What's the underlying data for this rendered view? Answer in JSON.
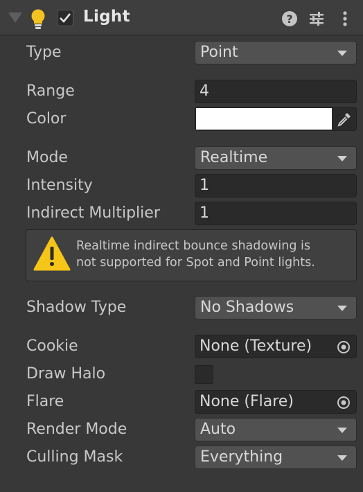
{
  "header": {
    "title": "Light",
    "enabled": true,
    "icons": [
      "foldout-arrow-icon",
      "light-bulb-icon",
      "help-icon",
      "presets-icon",
      "more-vert-icon"
    ]
  },
  "colors": {
    "background": "#383838",
    "header": "#3e3e3e",
    "bulb": "#f4c320",
    "warning": "#f5c518",
    "light_color": "#ffffff"
  },
  "properties": {
    "type": {
      "label": "Type",
      "value": "Point"
    },
    "range": {
      "label": "Range",
      "value": "4"
    },
    "color": {
      "label": "Color",
      "value": "#ffffff"
    },
    "mode": {
      "label": "Mode",
      "value": "Realtime"
    },
    "intensity": {
      "label": "Intensity",
      "value": "1"
    },
    "indirect_multiplier": {
      "label": "Indirect Multiplier",
      "value": "1"
    },
    "shadow_type": {
      "label": "Shadow Type",
      "value": "No Shadows"
    },
    "cookie": {
      "label": "Cookie",
      "value": "None (Texture)"
    },
    "draw_halo": {
      "label": "Draw Halo",
      "checked": false
    },
    "flare": {
      "label": "Flare",
      "value": "None (Flare)"
    },
    "render_mode": {
      "label": "Render Mode",
      "value": "Auto"
    },
    "culling_mask": {
      "label": "Culling Mask",
      "value": "Everything"
    }
  },
  "warning": {
    "line1": "Realtime indirect bounce shadowing is",
    "line2": "not supported for Spot and Point lights."
  }
}
